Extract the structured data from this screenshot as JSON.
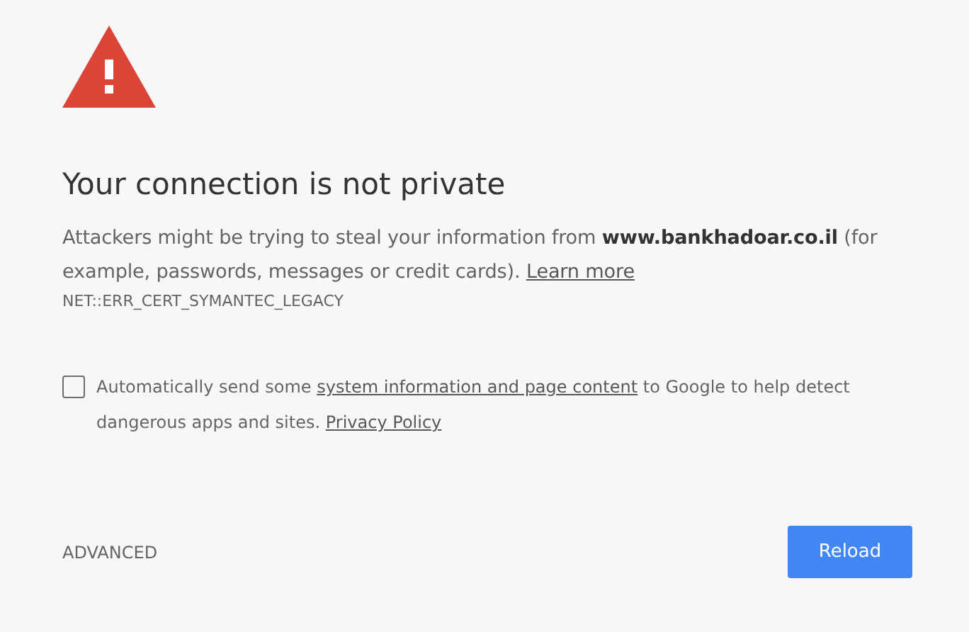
{
  "heading": "Your connection is not private",
  "description": {
    "text": "Attackers might be trying to steal your information from **www.bankhadoar.co.il** (for example, passwords, messages or credit cards).",
    "link": "Learn more"
  },
  "error_code": "NET::ERR_CERT_SYMANTEC_LEGACY",
  "report": {
    "checked": false,
    "segments": [
      {
        "kind": "text",
        "text": "Automatically send some"
      },
      {
        "kind": "link",
        "text": "system information and page content"
      },
      {
        "kind": "text",
        "text": "to Google to help detect dangerous apps and sites."
      },
      {
        "kind": "link",
        "text": "Privacy Policy"
      }
    ]
  },
  "advanced_label": "ADVANCED",
  "reload_label": "Reload"
}
